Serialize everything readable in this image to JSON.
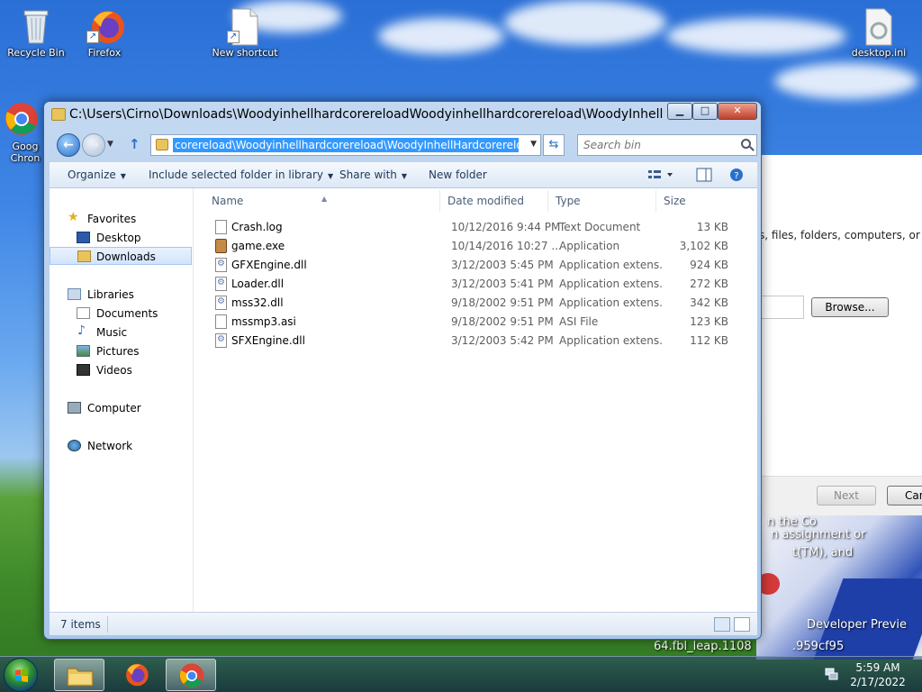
{
  "desktop": {
    "icons": [
      {
        "label": "Recycle Bin"
      },
      {
        "label": "Firefox"
      },
      {
        "label": "New shortcut"
      },
      {
        "label": "desktop.ini"
      },
      {
        "label": "Goog Chron"
      }
    ]
  },
  "wizard": {
    "description_fragment": "s, files, folders, computers, or",
    "browse_label": "Browse...",
    "next_label": "Next",
    "cancel_label": "Canc"
  },
  "background_art": {
    "line1": "n the Co",
    "line2": "n assignment or",
    "line3": "t(TM), and",
    "line4": "Developer Previe",
    "line5": "64.fbl_leap.1108",
    "line6": ".959cf95"
  },
  "explorer": {
    "title": "C:\\Users\\Cirno\\Downloads\\WoodyinhellhardcorereloadWoodyinhellhardcorereload\\WoodyInhellH...",
    "address_value": "corereload\\Woodyinhellhardcorereload\\WoodyInhellHardcorereload\\bin",
    "search_placeholder": "Search bin",
    "toolbar": {
      "organize": "Organize",
      "include_library": "Include selected folder in library",
      "share_with": "Share with",
      "new_folder": "New folder"
    },
    "nav": {
      "favorites": "Favorites",
      "desktop": "Desktop",
      "downloads": "Downloads",
      "libraries": "Libraries",
      "documents": "Documents",
      "music": "Music",
      "pictures": "Pictures",
      "videos": "Videos",
      "computer": "Computer",
      "network": "Network"
    },
    "columns": {
      "name": "Name",
      "date": "Date modified",
      "type": "Type",
      "size": "Size"
    },
    "files": [
      {
        "name": "Crash.log",
        "date": "10/12/2016 9:44 PM",
        "type": "Text Document",
        "size": "13 KB",
        "icon": "document-icon"
      },
      {
        "name": "game.exe",
        "date": "10/14/2016 10:27 ...",
        "type": "Application",
        "size": "3,102 KB",
        "icon": "application-icon"
      },
      {
        "name": "GFXEngine.dll",
        "date": "3/12/2003 5:45 PM",
        "type": "Application extens...",
        "size": "924 KB",
        "icon": "dll-icon"
      },
      {
        "name": "Loader.dll",
        "date": "3/12/2003 5:41 PM",
        "type": "Application extens...",
        "size": "272 KB",
        "icon": "dll-icon"
      },
      {
        "name": "mss32.dll",
        "date": "9/18/2002 9:51 PM",
        "type": "Application extens...",
        "size": "342 KB",
        "icon": "dll-icon"
      },
      {
        "name": "mssmp3.asi",
        "date": "9/18/2002 9:51 PM",
        "type": "ASI File",
        "size": "123 KB",
        "icon": "document-icon"
      },
      {
        "name": "SFXEngine.dll",
        "date": "3/12/2003 5:42 PM",
        "type": "Application extens...",
        "size": "112 KB",
        "icon": "dll-icon"
      }
    ],
    "status": "7 items"
  },
  "taskbar": {
    "time": "5:59 AM",
    "date": "2/17/2022"
  },
  "colors": {
    "selection": "#3399ff",
    "title_text": "#000000",
    "toolbar_text": "#1e395b"
  }
}
